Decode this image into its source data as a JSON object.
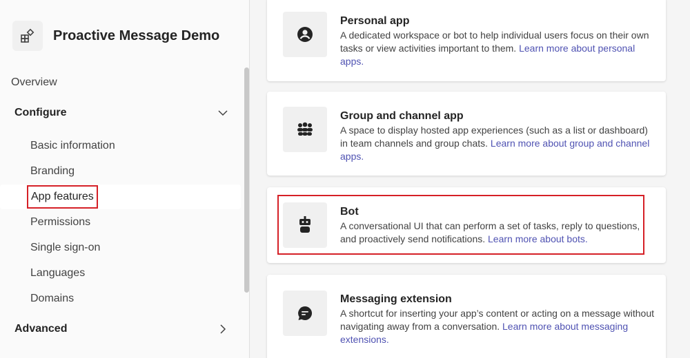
{
  "app": {
    "title": "Proactive Message Demo",
    "icon": "app-grid-icon"
  },
  "nav": {
    "overview": "Overview",
    "configure": {
      "label": "Configure",
      "icon": "chevron-down-icon"
    },
    "configure_items": [
      "Basic information",
      "Branding",
      "App features",
      "Permissions",
      "Single sign-on",
      "Languages",
      "Domains"
    ],
    "selected": "App features",
    "advanced": {
      "label": "Advanced",
      "icon": "chevron-right-icon"
    }
  },
  "features": [
    {
      "title": "Personal app",
      "desc": "A dedicated workspace or bot to help individual users focus on their own tasks or view activities important to them.",
      "link": "Learn more about personal apps.",
      "icon": "person-icon"
    },
    {
      "title": "Group and channel app",
      "desc": "A space to display hosted app experiences (such as a list or dashboard) in team channels and group chats.",
      "link": "Learn more about group and channel apps.",
      "icon": "people-group-icon"
    },
    {
      "title": "Bot",
      "desc": "A conversational UI that can perform a set of tasks, reply to questions, and proactively send notifications.",
      "link": "Learn more about bots.",
      "icon": "bot-icon"
    },
    {
      "title": "Messaging extension",
      "desc": "A shortcut for inserting your app’s content or acting on a message without navigating away from a conversation.",
      "link": "Learn more about messaging extensions.",
      "icon": "chat-bubble-icon"
    }
  ],
  "colors": {
    "accent_link": "#4f52b2",
    "highlight_red": "#d51f26"
  }
}
